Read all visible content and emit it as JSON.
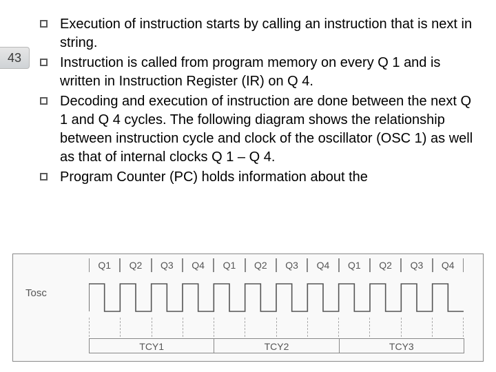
{
  "page_number": "43",
  "bullets": [
    "Execution of instruction starts by calling an instruction that is next in string.",
    "Instruction is called from program memory on every Q 1 and is written in Instruction Register (IR) on Q 4.",
    "Decoding and execution of instruction are done between the next Q 1 and Q 4 cycles. The following diagram shows the relationship between instruction cycle and clock of the oscillator (OSC 1) as well as that of internal clocks Q 1 – Q 4.",
    "Program Counter (PC) holds information about the"
  ],
  "diagram": {
    "q_labels": [
      "Q1",
      "Q2",
      "Q3",
      "Q4",
      "Q1",
      "Q2",
      "Q3",
      "Q4",
      "Q1",
      "Q2",
      "Q3",
      "Q4"
    ],
    "tosc_label": "Tosc",
    "tcy_labels": [
      "TCY1",
      "TCY2",
      "TCY3"
    ]
  }
}
